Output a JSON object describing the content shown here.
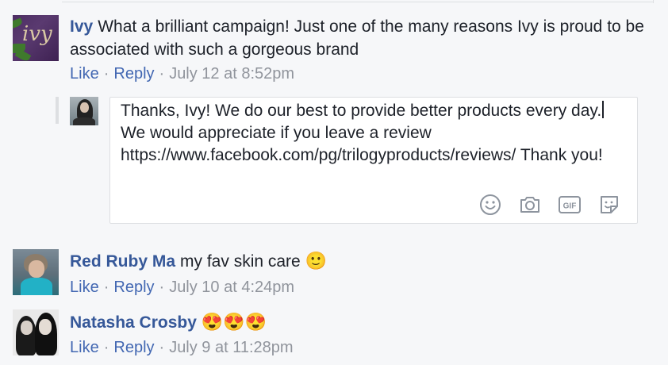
{
  "comments": [
    {
      "author": "Ivy",
      "text": "What a brilliant campaign! Just one of the many reasons Ivy is proud to be associated with such a gorgeous brand",
      "avatar_text": "ivy",
      "like": "Like",
      "reply": "Reply",
      "time": "July 12 at 8:52pm"
    },
    {
      "author": "Red Ruby Ma",
      "text": "my fav skin care",
      "emoji": "🙂",
      "like": "Like",
      "reply": "Reply",
      "time": "July 10 at 4:24pm"
    },
    {
      "author": "Natasha Crosby",
      "text": "",
      "emoji": "😍😍😍",
      "like": "Like",
      "reply": "Reply",
      "time": "July 9 at 11:28pm"
    }
  ],
  "reply_composer": {
    "text_before_caret": "Thanks, Ivy! We do our best to provide better products every day.",
    "text_after_caret": "We would appreciate if you leave a review https://www.facebook.com/pg/trilogyproducts/reviews/ Thank you!",
    "icons": [
      "emoji-icon",
      "camera-icon",
      "gif-icon",
      "sticker-icon"
    ],
    "gif_label": "GIF"
  },
  "colors": {
    "author_link": "#365899",
    "action_link": "#4267b2",
    "meta_gray": "#90949c",
    "background": "#f6f7f9"
  }
}
